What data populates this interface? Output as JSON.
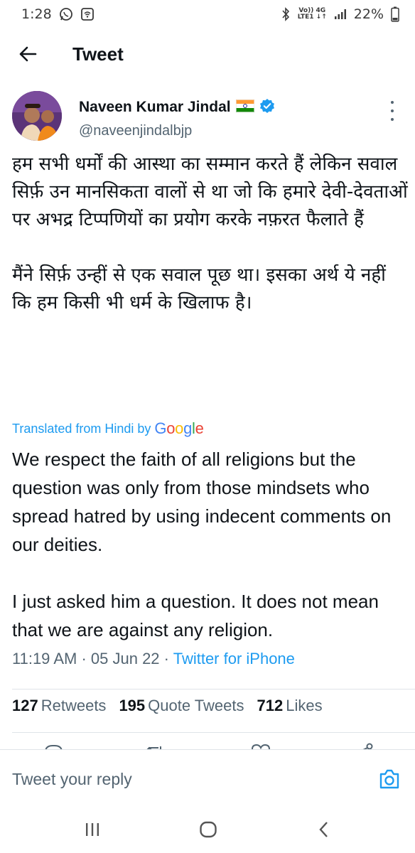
{
  "status_bar": {
    "time": "1:28",
    "network_top": "Vo)) 4G",
    "network_bottom": "LTE1 ↓↑",
    "battery": "22%"
  },
  "header": {
    "title": "Tweet",
    "back_icon": "arrow-left-icon"
  },
  "tweet": {
    "author": {
      "display_name": "Naveen Kumar Jindal",
      "flag": "🇮🇳",
      "verified_icon": "verified-badge-icon",
      "handle": "@naveenjindalbjp"
    },
    "hindi_text": "हम सभी धर्मों की आस्था का सम्मान करते हैं लेकिन सवाल सिर्फ़ उन मानसिकता वालों से था जो कि हमारे देवी-देवताओं पर अभद्र टिप्पणियों का प्रयोग करके नफ़रत फैलाते हैं\n\nमैंने सिर्फ़ उन्हीं से एक सवाल पूछ था। इसका अर्थ ये नहीं कि हम किसी भी धर्म के खिलाफ है।",
    "translated_label": "Translated from Hindi by",
    "translator": "Google",
    "english_text": "We respect the faith of all religions but the question was only from those mindsets who spread hatred by using indecent comments on our deities.\n\n I just asked him a question. It does not mean that we are against any religion.",
    "time": "11:19 AM",
    "separator": "·",
    "date": "05 Jun 22",
    "source": "Twitter for iPhone"
  },
  "stats": {
    "retweets_count": "127",
    "retweets_label": "Retweets",
    "quotes_count": "195",
    "quotes_label": "Quote Tweets",
    "likes_count": "712",
    "likes_label": "Likes"
  },
  "reply": {
    "placeholder": "Tweet your reply"
  },
  "colors": {
    "accent": "#1d9bf0",
    "text": "#0f1419",
    "secondary": "#536471"
  }
}
